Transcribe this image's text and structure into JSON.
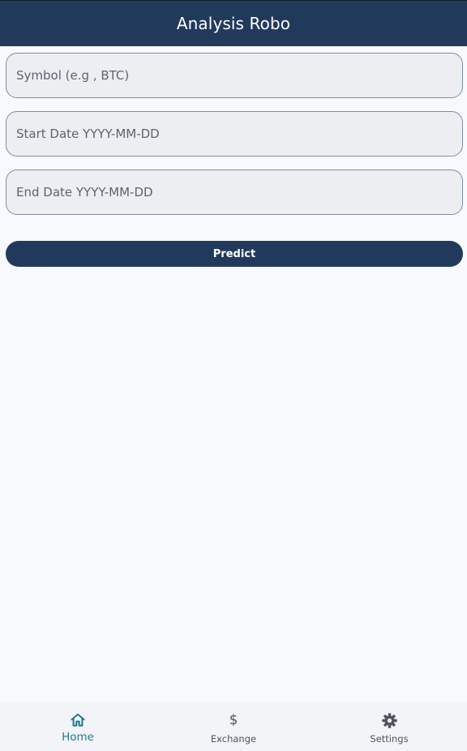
{
  "header": {
    "title": "Analysis Robo"
  },
  "form": {
    "symbol_placeholder": "Symbol (e.g , BTC)",
    "start_date_placeholder": "Start Date YYYY-MM-DD",
    "end_date_placeholder": "End Date YYYY-MM-DD",
    "predict_label": "Predict"
  },
  "nav": {
    "items": [
      {
        "label": "Home",
        "icon": "home-icon",
        "active": true
      },
      {
        "label": "Exchange",
        "icon": "dollar-icon",
        "active": false
      },
      {
        "label": "Settings",
        "icon": "gear-icon",
        "active": false
      }
    ]
  },
  "colors": {
    "primary": "#213a5c",
    "active": "#1d7a8c",
    "background": "#f8f9fc"
  }
}
